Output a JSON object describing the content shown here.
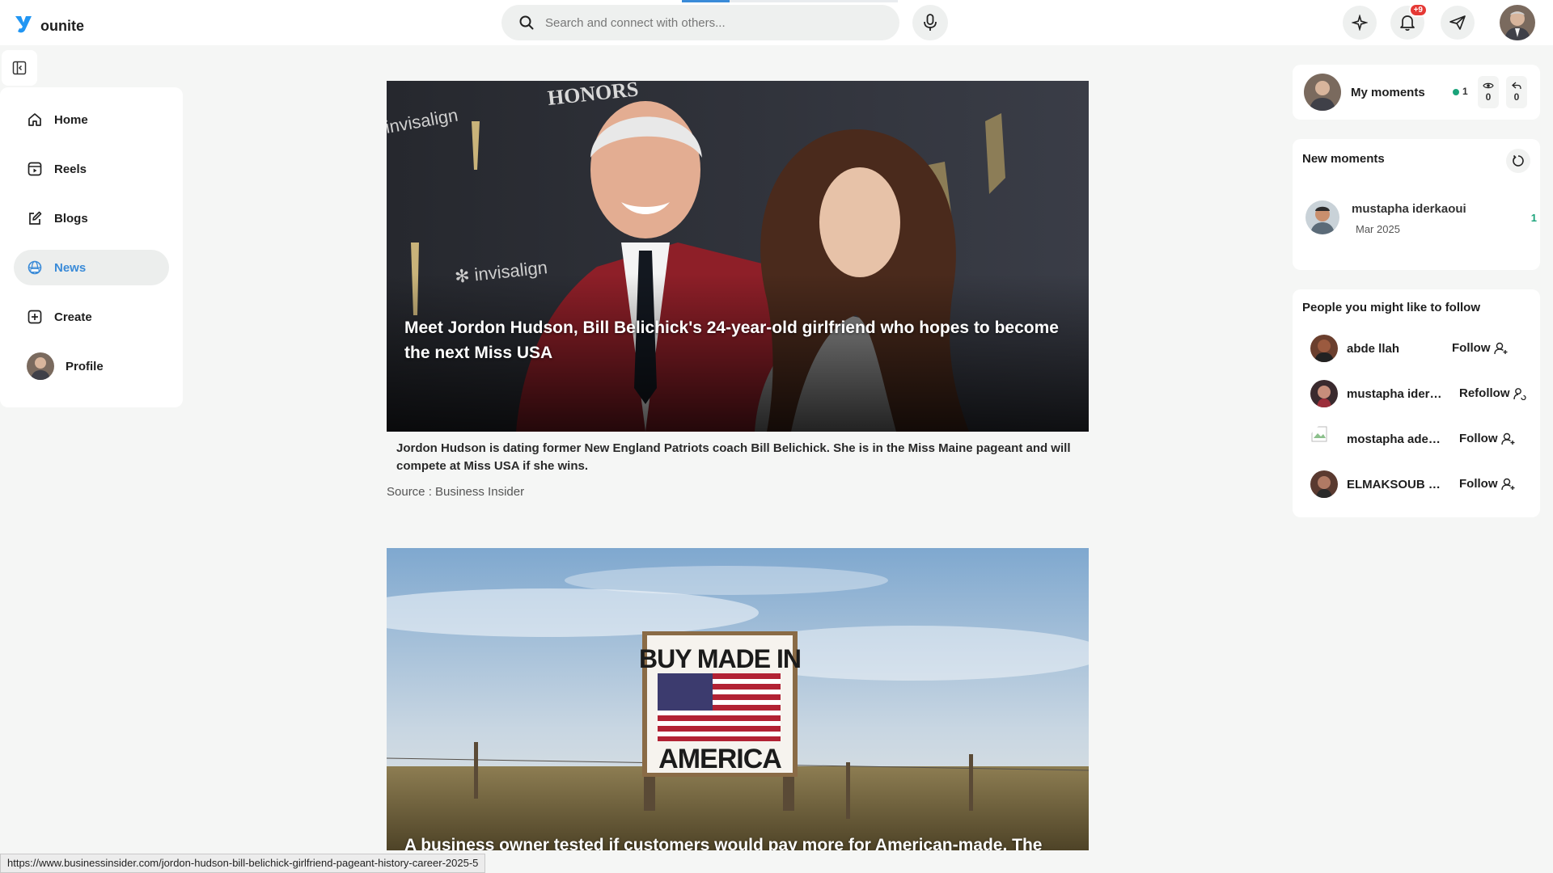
{
  "app": {
    "name": "ounite",
    "brand_color": "#2196f3",
    "accent_color": "#3a8bd8"
  },
  "header": {
    "search": {
      "placeholder": "Search and connect with others..."
    },
    "icons": [
      "search-icon",
      "microphone-icon",
      "ai-sparkle-icon",
      "bell-icon",
      "send-icon"
    ],
    "notification_badge": "+9"
  },
  "sidebar": {
    "items": [
      {
        "label": "Home",
        "icon": "home-icon"
      },
      {
        "label": "Reels",
        "icon": "reels-icon"
      },
      {
        "label": "Blogs",
        "icon": "blog-edit-icon"
      },
      {
        "label": "News",
        "icon": "news-globe-icon",
        "active": true
      },
      {
        "label": "Create",
        "icon": "plus-square-icon"
      },
      {
        "label": "Profile",
        "icon": "avatar"
      }
    ]
  },
  "feed": {
    "articles": [
      {
        "title": "Meet Jordon Hudson, Bill Belichick's 24-year-old girlfriend who hopes to become the next Miss USA",
        "description": "Jordon Hudson is dating former New England Patriots coach Bill Belichick. She is in the Miss Maine pageant and will compete at Miss USA if she wins.",
        "source": "Source : Business Insider"
      },
      {
        "title": "A business owner tested if customers would pay more for American-made. The",
        "sign_text_top": "BUY MADE IN",
        "sign_text_bottom": "AMERICA"
      }
    ]
  },
  "right": {
    "my_moments": {
      "label": "My moments",
      "active_count": "1",
      "views": "0",
      "replies": "0"
    },
    "new_moments": {
      "title": "New moments",
      "items": [
        {
          "name": "mustapha iderkaoui",
          "date": "Mar 2025",
          "count": "1"
        }
      ]
    },
    "suggestions": {
      "title": "People you might like to follow",
      "people": [
        {
          "name": "abde llah",
          "action": "Follow"
        },
        {
          "name": "mustapha iderkaoui",
          "action": "Refollow"
        },
        {
          "name": "mostapha aderkaoui",
          "action": "Follow"
        },
        {
          "name": "ELMAKSOUB NOUHAILA",
          "action": "Follow"
        }
      ]
    }
  },
  "status_bar": {
    "url": "https://www.businessinsider.com/jordon-hudson-bill-belichick-girlfriend-pageant-history-career-2025-5"
  }
}
